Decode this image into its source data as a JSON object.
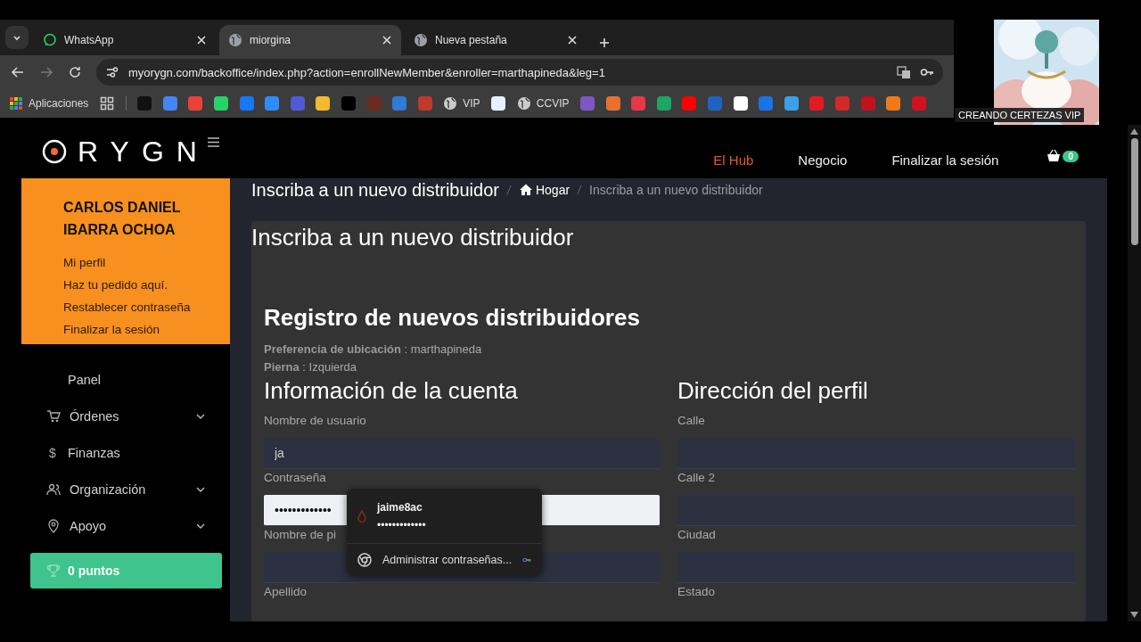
{
  "browser": {
    "tabs": [
      {
        "title": "WhatsApp",
        "kind": "whatsapp",
        "selected": false
      },
      {
        "title": "miorgina",
        "kind": "globe",
        "selected": true
      },
      {
        "title": "Nueva pestaña",
        "kind": "globe",
        "selected": false
      }
    ],
    "address_bar": {
      "url": "myorygn.com/backoffice/index.php?action=enrollNewMember&enroller=marthapineda&leg=1",
      "forward_disabled": true
    },
    "bookmarks": [
      {
        "kind": "apps",
        "label": "Aplicaciones"
      },
      {
        "kind": "grid"
      },
      {
        "kind": "separator"
      },
      {
        "kind": "site",
        "color": "#111111"
      },
      {
        "kind": "site",
        "color": "#4285f4"
      },
      {
        "kind": "site",
        "color": "#ea4335"
      },
      {
        "kind": "site",
        "color": "#25d366"
      },
      {
        "kind": "site",
        "color": "#1877f2"
      },
      {
        "kind": "site",
        "color": "#2d8cff"
      },
      {
        "kind": "site",
        "color": "#4f5bd5"
      },
      {
        "kind": "site",
        "color": "#f3ba2f"
      },
      {
        "kind": "site",
        "color": "#000000"
      },
      {
        "kind": "site",
        "color": "#6b2a20"
      },
      {
        "kind": "site",
        "color": "#2f7bd6"
      },
      {
        "kind": "site",
        "color": "#c0392b"
      },
      {
        "kind": "globe",
        "label": "VIP"
      },
      {
        "kind": "site",
        "color": "#e6f0ff"
      },
      {
        "kind": "globe",
        "label": "CCVIP"
      },
      {
        "kind": "site",
        "color": "#7e57c2"
      },
      {
        "kind": "site",
        "color": "#e8712e"
      },
      {
        "kind": "site",
        "color": "#e53945"
      },
      {
        "kind": "site",
        "color": "#1fa463"
      },
      {
        "kind": "site",
        "color": "#ff0000"
      },
      {
        "kind": "site",
        "color": "#1e63c4"
      },
      {
        "kind": "site",
        "color": "#ffffff"
      },
      {
        "kind": "site",
        "color": "#1a73e8"
      },
      {
        "kind": "site",
        "color": "#3aa0e8"
      },
      {
        "kind": "site",
        "color": "#e01b24"
      },
      {
        "kind": "site",
        "color": "#d62828"
      },
      {
        "kind": "site",
        "color": "#c1121f"
      },
      {
        "kind": "site",
        "color": "#f07a1a"
      },
      {
        "kind": "site",
        "color": "#d3121f"
      }
    ]
  },
  "webcam": {
    "kind": "picture",
    "caption": "CREANDO CERTEZAS VIP"
  },
  "header": {
    "logo": "RYGN",
    "nav": [
      {
        "label": "El Hub",
        "selected": true
      },
      {
        "label": "Negocio",
        "selected": false
      },
      {
        "label": "Finalizar la sesión",
        "selected": false
      }
    ],
    "cart_count": "0"
  },
  "profile": {
    "name": "CARLOS DANIEL IBARRA OCHOA",
    "links": [
      "Mi perfil",
      "Haz tu pedido aquí.",
      "Restablecer contraseña",
      "Finalizar la sesión"
    ]
  },
  "sidebar": {
    "items": [
      {
        "label": "Panel",
        "kind": "plain",
        "expandable": false
      },
      {
        "label": "Órdenes",
        "kind": "cart",
        "expandable": true
      },
      {
        "label": "Finanzas",
        "kind": "glyph",
        "glyph": "$",
        "expandable": false
      },
      {
        "label": "Organización",
        "kind": "people",
        "expandable": true
      },
      {
        "label": "Apoyo",
        "kind": "pin",
        "expandable": true
      }
    ],
    "points": "0 puntos"
  },
  "breadcrumb": {
    "title": "Inscriba a un nuevo distribuidor",
    "items": [
      {
        "label": "Hogar",
        "current": false
      },
      {
        "label": "Inscriba a un nuevo distribuidor",
        "current": true
      }
    ]
  },
  "page_title": "Inscriba a un nuevo distribuidor",
  "form": {
    "title": "Registro de nuevos distribuidores",
    "info": [
      "**Preferencia de ubicación** : marthapineda",
      "**Pierna** : Izquierda"
    ],
    "columns": [
      {
        "title": "Información de la cuenta",
        "fields": [
          {
            "label": "Nombre de usuario",
            "kind": "input",
            "value": "ja",
            "autofilled": false
          },
          {
            "label": "Contraseña",
            "kind": "input",
            "value": "•••••••••••••",
            "autofilled": true
          },
          {
            "label": "Nombre de pi",
            "kind": "input",
            "autofilled": false
          },
          {
            "label": "Apellido",
            "kind": "label"
          }
        ]
      },
      {
        "title": "Dirección del perfil",
        "fields": [
          {
            "label": "Calle",
            "kind": "input",
            "autofilled": false
          },
          {
            "label": "Calle 2",
            "kind": "input",
            "autofilled": false
          },
          {
            "label": "Ciudad",
            "kind": "input",
            "autofilled": false
          },
          {
            "label": "Estado",
            "kind": "label"
          }
        ]
      }
    ]
  },
  "autofill_popup": {
    "username": "jaime8ac",
    "password": "•••••••••••••",
    "manage": "Administrar contraseñas..."
  }
}
